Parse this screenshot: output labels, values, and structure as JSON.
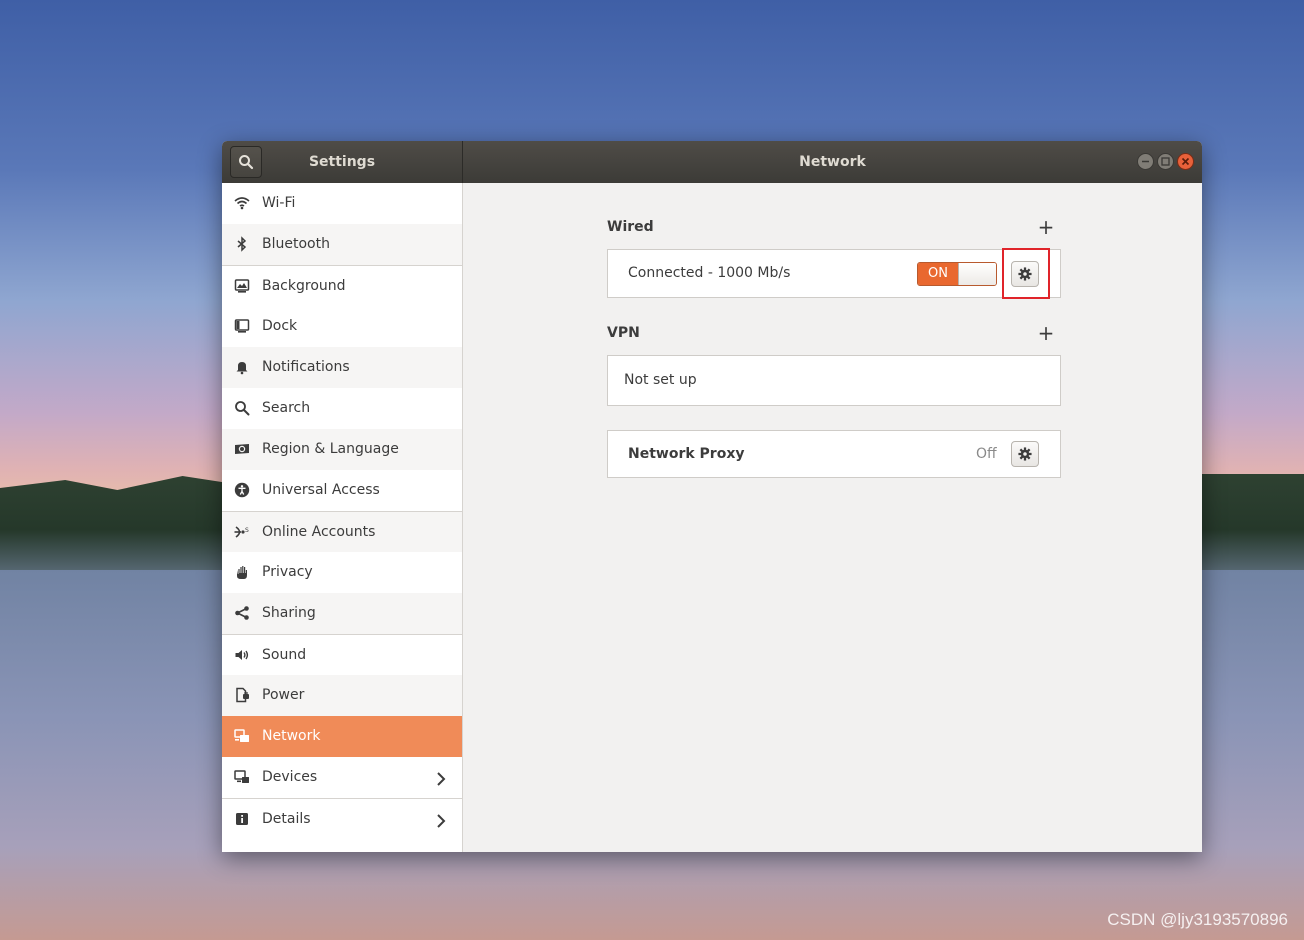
{
  "window": {
    "left_title": "Settings",
    "right_title": "Network"
  },
  "sidebar": {
    "items": [
      {
        "label": "Wi-Fi",
        "icon": "wifi-icon"
      },
      {
        "label": "Bluetooth",
        "icon": "bluetooth-icon"
      },
      {
        "label": "Background",
        "icon": "background-icon"
      },
      {
        "label": "Dock",
        "icon": "dock-icon"
      },
      {
        "label": "Notifications",
        "icon": "bell-icon"
      },
      {
        "label": "Search",
        "icon": "search-icon"
      },
      {
        "label": "Region & Language",
        "icon": "region-icon"
      },
      {
        "label": "Universal Access",
        "icon": "accessibility-icon"
      },
      {
        "label": "Online Accounts",
        "icon": "online-accounts-icon"
      },
      {
        "label": "Privacy",
        "icon": "hand-icon"
      },
      {
        "label": "Sharing",
        "icon": "share-icon"
      },
      {
        "label": "Sound",
        "icon": "speaker-icon"
      },
      {
        "label": "Power",
        "icon": "power-icon"
      },
      {
        "label": "Network",
        "icon": "network-icon",
        "active": true
      },
      {
        "label": "Devices",
        "icon": "devices-icon",
        "chevron": "›"
      },
      {
        "label": "Details",
        "icon": "info-icon",
        "chevron": "›"
      }
    ]
  },
  "network": {
    "wired": {
      "title": "Wired",
      "add": "+",
      "status": "Connected - 1000 Mb/s",
      "toggle_label": "ON"
    },
    "vpn": {
      "title": "VPN",
      "add": "+",
      "status": "Not set up"
    },
    "proxy": {
      "title": "Network Proxy",
      "value": "Off"
    }
  },
  "colors": {
    "accent": "#f08b58",
    "toggle": "#e9682f",
    "highlight": "#e0242a"
  },
  "watermark": "CSDN @ljy3193570896"
}
